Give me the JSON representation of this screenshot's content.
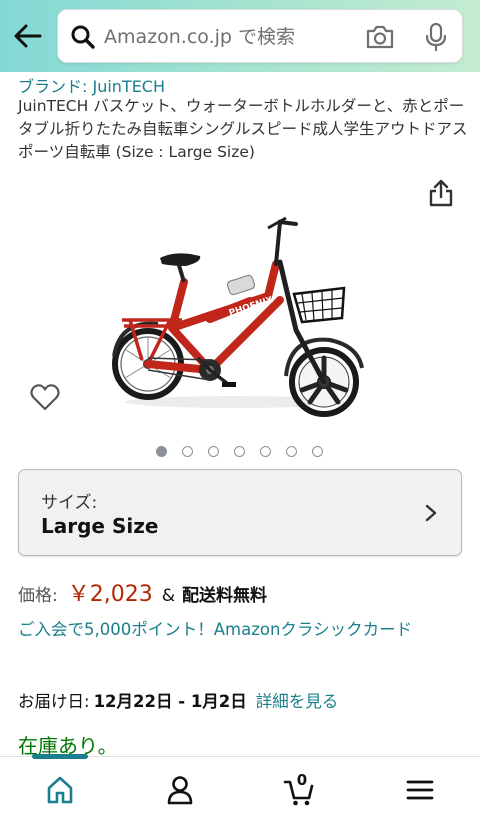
{
  "colors": {
    "accent_link": "#1a7f8c",
    "price": "#b12704",
    "in_stock": "#007600",
    "header_gradient_start": "#83d8d6",
    "header_gradient_end": "#c4ecd1"
  },
  "header": {
    "search": {
      "placeholder": "Amazon.co.jp で検索",
      "value": ""
    },
    "icons": {
      "back": "arrow-left",
      "search": "magnifier",
      "camera": "camera",
      "mic": "microphone"
    }
  },
  "product": {
    "brand": "ブランド: JuinTECH",
    "title": "JuinTECH バスケット、ウォーターボトルホルダーと、赤とポータブル折りたたみ自転車シングルスピード成人学生アウトドアスポーツ自転車 (Size : Large Size)",
    "image_brand_text": "PHOENIX",
    "carousel": {
      "count": 7,
      "active_index": 0
    }
  },
  "size_selector": {
    "label": "サイズ:",
    "value": "Large Size"
  },
  "price": {
    "label": "価格:",
    "value": "￥2,023",
    "amp": "&",
    "shipping": "配送料無料"
  },
  "points": {
    "text": "ご入会で5,000ポイント！Amazonクラシックカード"
  },
  "delivery": {
    "label": "お届け日:",
    "dates": "12月22日 - 1月2日",
    "details_link": "詳細を見る"
  },
  "stock": {
    "status": "在庫あり。"
  },
  "bottom_nav": {
    "items": [
      {
        "icon": "home",
        "active": true
      },
      {
        "icon": "user",
        "active": false
      },
      {
        "icon": "cart",
        "active": false
      },
      {
        "icon": "menu",
        "active": false
      }
    ],
    "cart_count": "0"
  }
}
